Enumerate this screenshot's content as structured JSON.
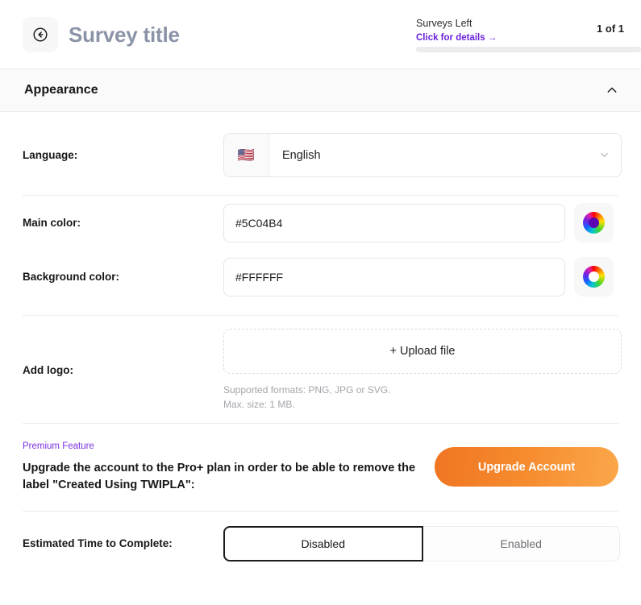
{
  "header": {
    "back_icon": "arrow-left-circle-icon",
    "title": "Survey title",
    "surveys_left_label": "Surveys Left",
    "surveys_left_link": "Click for details →",
    "surveys_count": "1 of 1",
    "progress_percent": 0
  },
  "section": {
    "title": "Appearance",
    "collapse_icon": "chevron-up-icon",
    "expanded": true
  },
  "language": {
    "label": "Language:",
    "flag": "🇺🇸",
    "value": "English",
    "chevron_icon": "chevron-down-icon",
    "options": [
      "English"
    ]
  },
  "main_color": {
    "label": "Main color:",
    "value": "#5C04B4",
    "placeholder": "#5C04B4",
    "swatch_icon": "color-wheel-icon"
  },
  "background_color": {
    "label": "Background color:",
    "value": "#FFFFFF",
    "placeholder": "#FFFFFF",
    "swatch_icon": "color-wheel-icon"
  },
  "logo": {
    "label": "Add logo:",
    "upload_label": "+ Upload file",
    "hint_formats": "Supported formats: PNG, JPG or SVG.",
    "hint_size": "Max. size: 1 MB."
  },
  "premium": {
    "tag": "Premium Feature",
    "description": "Upgrade the account to the Pro+ plan in order to be able to remove the label \"Created Using TWIPLA\":",
    "button_label": "Upgrade Account"
  },
  "estimated_time": {
    "label": "Estimated Time to Complete:",
    "option_disabled": "Disabled",
    "option_enabled": "Enabled",
    "selected": "Disabled"
  },
  "colors": {
    "accent_purple": "#6B21D8",
    "premium_purple": "#7B2FE0",
    "title_gray": "#8B93A7",
    "orange_start": "#F07522",
    "orange_end": "#FBA74A",
    "border": "#ECECEE"
  }
}
